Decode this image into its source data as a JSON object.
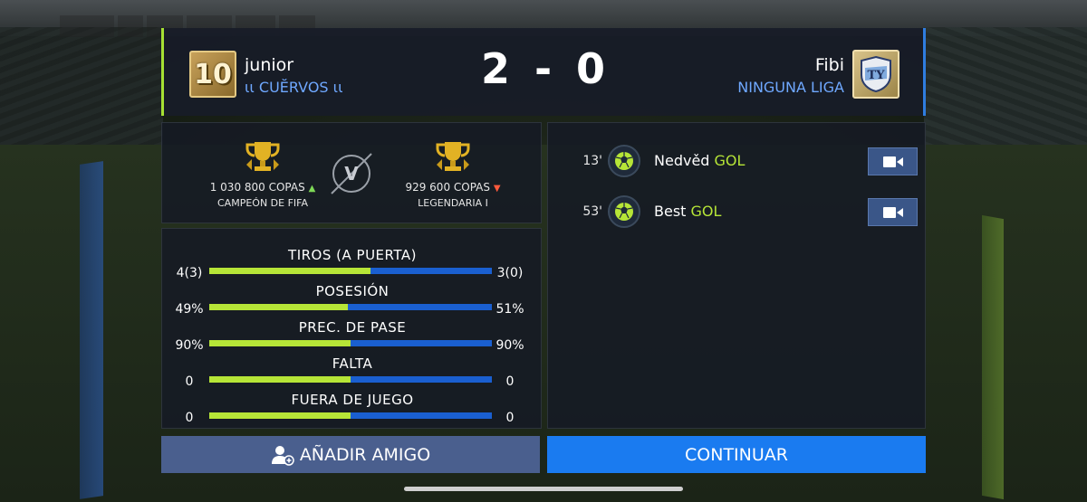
{
  "header": {
    "player1": {
      "badge_number": "10",
      "name": "junior",
      "club": "ιι CUĔRVOS ιι"
    },
    "score": {
      "home": "2",
      "separator": "-",
      "away": "0"
    },
    "player2": {
      "name": "Fibi",
      "club": "NINGUNA LIGA",
      "badge": "TOTY"
    }
  },
  "trophies": {
    "left": {
      "copas": "1 030 800 COPAS",
      "trend": "▲",
      "rank": "CAMPEÓN DE FIFA"
    },
    "vs_label": "V",
    "right": {
      "copas": "929 600 COPAS",
      "trend": "▼",
      "rank": "LEGENDARIA I"
    }
  },
  "stats": [
    {
      "title": "TIROS (A PUERTA)",
      "left": "4(3)",
      "right": "3(0)",
      "left_share": 0.57
    },
    {
      "title": "POSESIÓN",
      "left": "49%",
      "right": "51%",
      "left_share": 0.49
    },
    {
      "title": "PREC. DE PASE",
      "left": "90%",
      "right": "90%",
      "left_share": 0.5
    },
    {
      "title": "FALTA",
      "left": "0",
      "right": "0",
      "left_share": 0.5
    },
    {
      "title": "FUERA DE JUEGO",
      "left": "0",
      "right": "0",
      "left_share": 0.5
    }
  ],
  "events": [
    {
      "minute": "13'",
      "player": "Nedvěd",
      "type": "GOL"
    },
    {
      "minute": "53'",
      "player": "Best",
      "type": "GOL"
    }
  ],
  "buttons": {
    "add_friend": "AÑADIR AMIGO",
    "continue": "CONTINUAR"
  },
  "colors": {
    "home_accent": "#b6e537",
    "away_accent": "#1a5fd0",
    "continue_bg": "#1a7bf0"
  }
}
